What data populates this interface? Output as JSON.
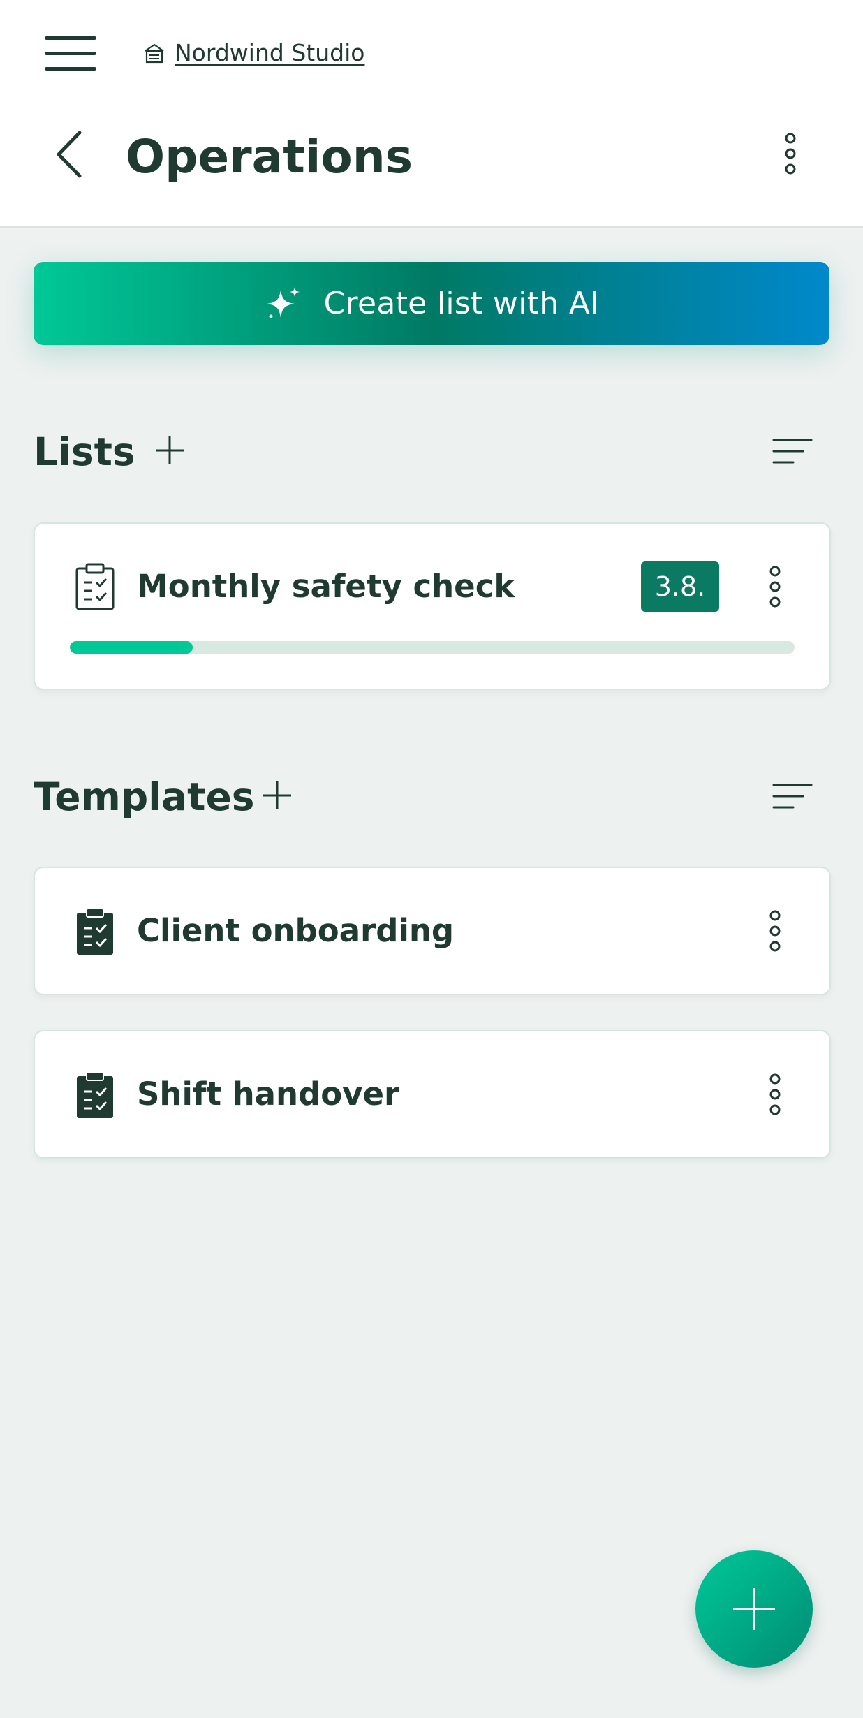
{
  "header": {
    "workspace_name": "Nordwind Studio",
    "workspace_icon": "building-icon",
    "menu_icon": "hamburger-menu-icon",
    "back_icon": "chevron-left-icon",
    "page_title": "Operations",
    "more_icon": "more-vertical-icon"
  },
  "ai_button": {
    "label": "Create list with AI",
    "icon": "sparkle-icon",
    "gradient": [
      "#00c897",
      "#007a64",
      "#0088cc"
    ]
  },
  "lists_section": {
    "title": "Lists",
    "add_icon": "plus-icon",
    "sort_icon": "sort-icon",
    "items": [
      {
        "title": "Monthly safety check",
        "icon": "clipboard-check-outline-icon",
        "badge": "3.8.",
        "progress": 0.17
      }
    ]
  },
  "templates_section": {
    "title": "Templates",
    "add_icon": "plus-icon",
    "sort_icon": "sort-icon",
    "items": [
      {
        "title": "Client onboarding",
        "icon": "clipboard-check-filled-icon"
      },
      {
        "title": "Shift handover",
        "icon": "clipboard-check-filled-icon"
      }
    ]
  },
  "fab": {
    "icon": "plus-icon"
  },
  "colors": {
    "accent": "#00c897",
    "accent_dark": "#0a7a63",
    "text": "#1f3a30",
    "background": "#edf1f0",
    "progress_track": "#d7e9e1"
  }
}
